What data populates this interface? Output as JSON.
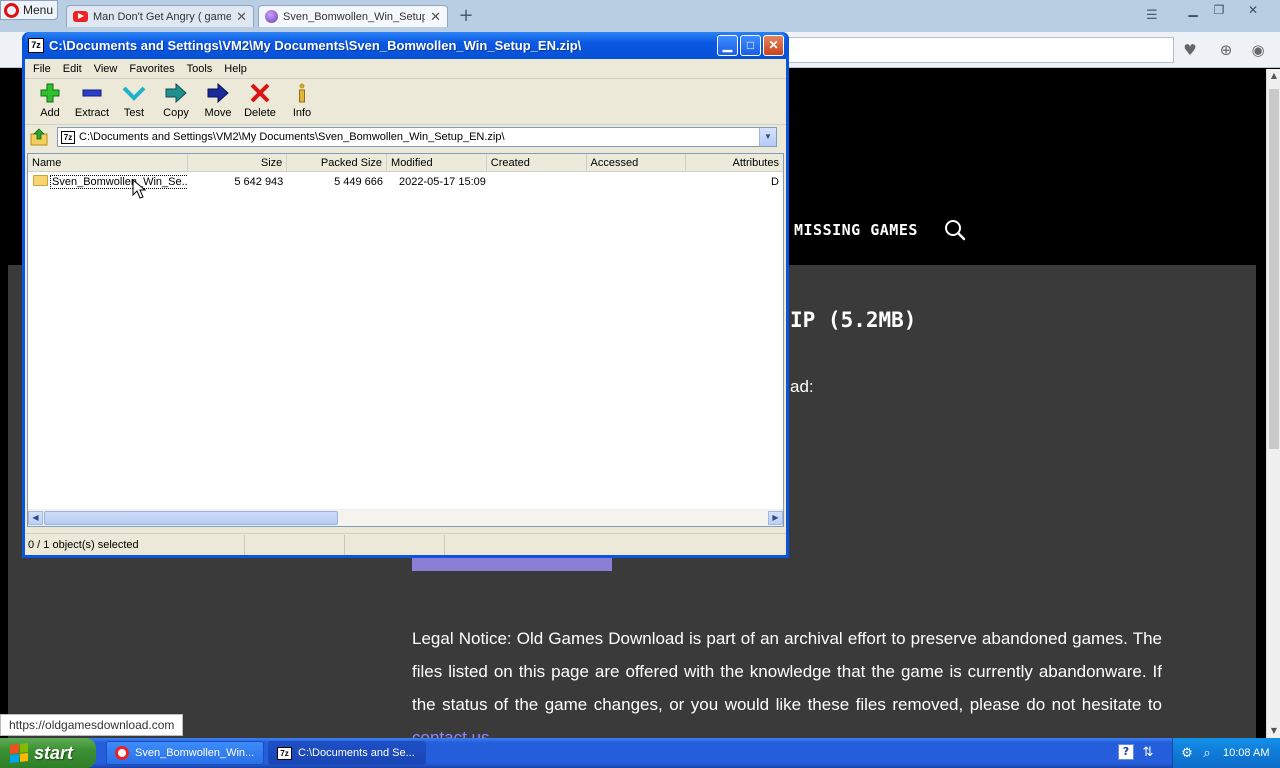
{
  "browser": {
    "menu_label": "Menu",
    "tabs": [
      {
        "label": "Man Don't Get Angry ( game",
        "close": "✕"
      },
      {
        "label": "Sven_Bomwollen_Win_Setup",
        "close": "✕"
      }
    ],
    "new_tab": "+",
    "status_url": "https://oldgamesdownload.com"
  },
  "webpage": {
    "nav_missing_games": "MISSING GAMES",
    "download_heading": "IP (5.2MB)",
    "download_sub": "ad:",
    "legal_notice": "Legal Notice: Old Games Download is part of an archival effort to preserve abandoned games. The files listed on this page are offered with the knowledge that the game is currently abandonware. If the status of the game changes, or you would like these files removed, please do not hesitate to",
    "contact_link": "contact us"
  },
  "zip": {
    "title": "C:\\Documents and Settings\\VM2\\My Documents\\Sven_Bomwollen_Win_Setup_EN.zip\\",
    "icon_text": "7z",
    "menus": [
      "File",
      "Edit",
      "View",
      "Favorites",
      "Tools",
      "Help"
    ],
    "toolbar": [
      {
        "label": "Add",
        "icon": "add-icon"
      },
      {
        "label": "Extract",
        "icon": "extract-icon"
      },
      {
        "label": "Test",
        "icon": "test-icon"
      },
      {
        "label": "Copy",
        "icon": "copy-icon"
      },
      {
        "label": "Move",
        "icon": "move-icon"
      },
      {
        "label": "Delete",
        "icon": "delete-icon"
      },
      {
        "label": "Info",
        "icon": "info-icon"
      }
    ],
    "path": "C:\\Documents and Settings\\VM2\\My Documents\\Sven_Bomwollen_Win_Setup_EN.zip\\",
    "columns": [
      "Name",
      "Size",
      "Packed Size",
      "Modified",
      "Created",
      "Accessed",
      "Attributes"
    ],
    "rows": [
      {
        "name": "Sven_Bomwollen_Win_Se...",
        "size": "5 642 943",
        "packed": "5 449 666",
        "modified": "2022-05-17 15:09",
        "created": "",
        "accessed": "",
        "attributes": "D"
      }
    ],
    "status": "0 / 1 object(s) selected"
  },
  "taskbar": {
    "start_label": "start",
    "buttons": [
      {
        "label": "Sven_Bomwollen_Win..."
      },
      {
        "label": "C:\\Documents and Se..."
      }
    ],
    "clock": "10:08 AM",
    "help_tray": "?"
  },
  "colors": {
    "xp_blue": "#0a55e0",
    "start_green": "#3c9133",
    "link_purple": "#8e86ff",
    "button_purple": "#8a7fd4"
  }
}
